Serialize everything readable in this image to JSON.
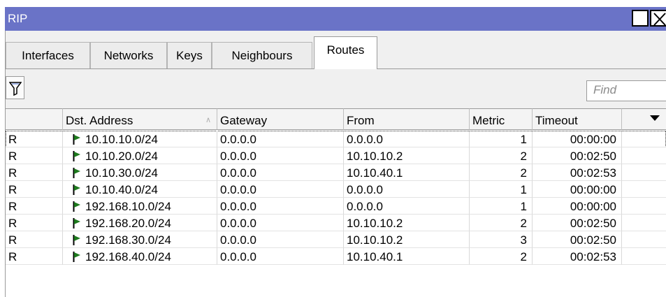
{
  "window": {
    "title": "RIP"
  },
  "tabs": [
    {
      "label": "Interfaces",
      "active": false
    },
    {
      "label": "Networks",
      "active": false
    },
    {
      "label": "Keys",
      "active": false
    },
    {
      "label": "Neighbours",
      "active": false
    },
    {
      "label": "Routes",
      "active": true
    }
  ],
  "toolbar": {
    "filter_icon": "filter-icon",
    "find_placeholder": "Find"
  },
  "table": {
    "columns": [
      "",
      "Dst. Address",
      "Gateway",
      "From",
      "Metric",
      "Timeout"
    ],
    "sort_column": "Dst. Address",
    "rows": [
      {
        "flag": "R",
        "dst": "10.10.10.0/24",
        "gateway": "0.0.0.0",
        "from": "0.0.0.0",
        "metric": "1",
        "timeout": "00:00:00"
      },
      {
        "flag": "R",
        "dst": "10.10.20.0/24",
        "gateway": "0.0.0.0",
        "from": "10.10.10.2",
        "metric": "2",
        "timeout": "00:02:50"
      },
      {
        "flag": "R",
        "dst": "10.10.30.0/24",
        "gateway": "0.0.0.0",
        "from": "10.10.40.1",
        "metric": "2",
        "timeout": "00:02:53"
      },
      {
        "flag": "R",
        "dst": "10.10.40.0/24",
        "gateway": "0.0.0.0",
        "from": "0.0.0.0",
        "metric": "1",
        "timeout": "00:00:00"
      },
      {
        "flag": "R",
        "dst": "192.168.10.0/24",
        "gateway": "0.0.0.0",
        "from": "0.0.0.0",
        "metric": "1",
        "timeout": "00:00:00"
      },
      {
        "flag": "R",
        "dst": "192.168.20.0/24",
        "gateway": "0.0.0.0",
        "from": "10.10.10.2",
        "metric": "2",
        "timeout": "00:02:50"
      },
      {
        "flag": "R",
        "dst": "192.168.30.0/24",
        "gateway": "0.0.0.0",
        "from": "10.10.10.2",
        "metric": "3",
        "timeout": "00:02:50"
      },
      {
        "flag": "R",
        "dst": "192.168.40.0/24",
        "gateway": "0.0.0.0",
        "from": "10.10.40.1",
        "metric": "2",
        "timeout": "00:02:53"
      }
    ]
  },
  "colors": {
    "titlebar": "#6a73c7",
    "route_flag": "#1e7a1e"
  }
}
